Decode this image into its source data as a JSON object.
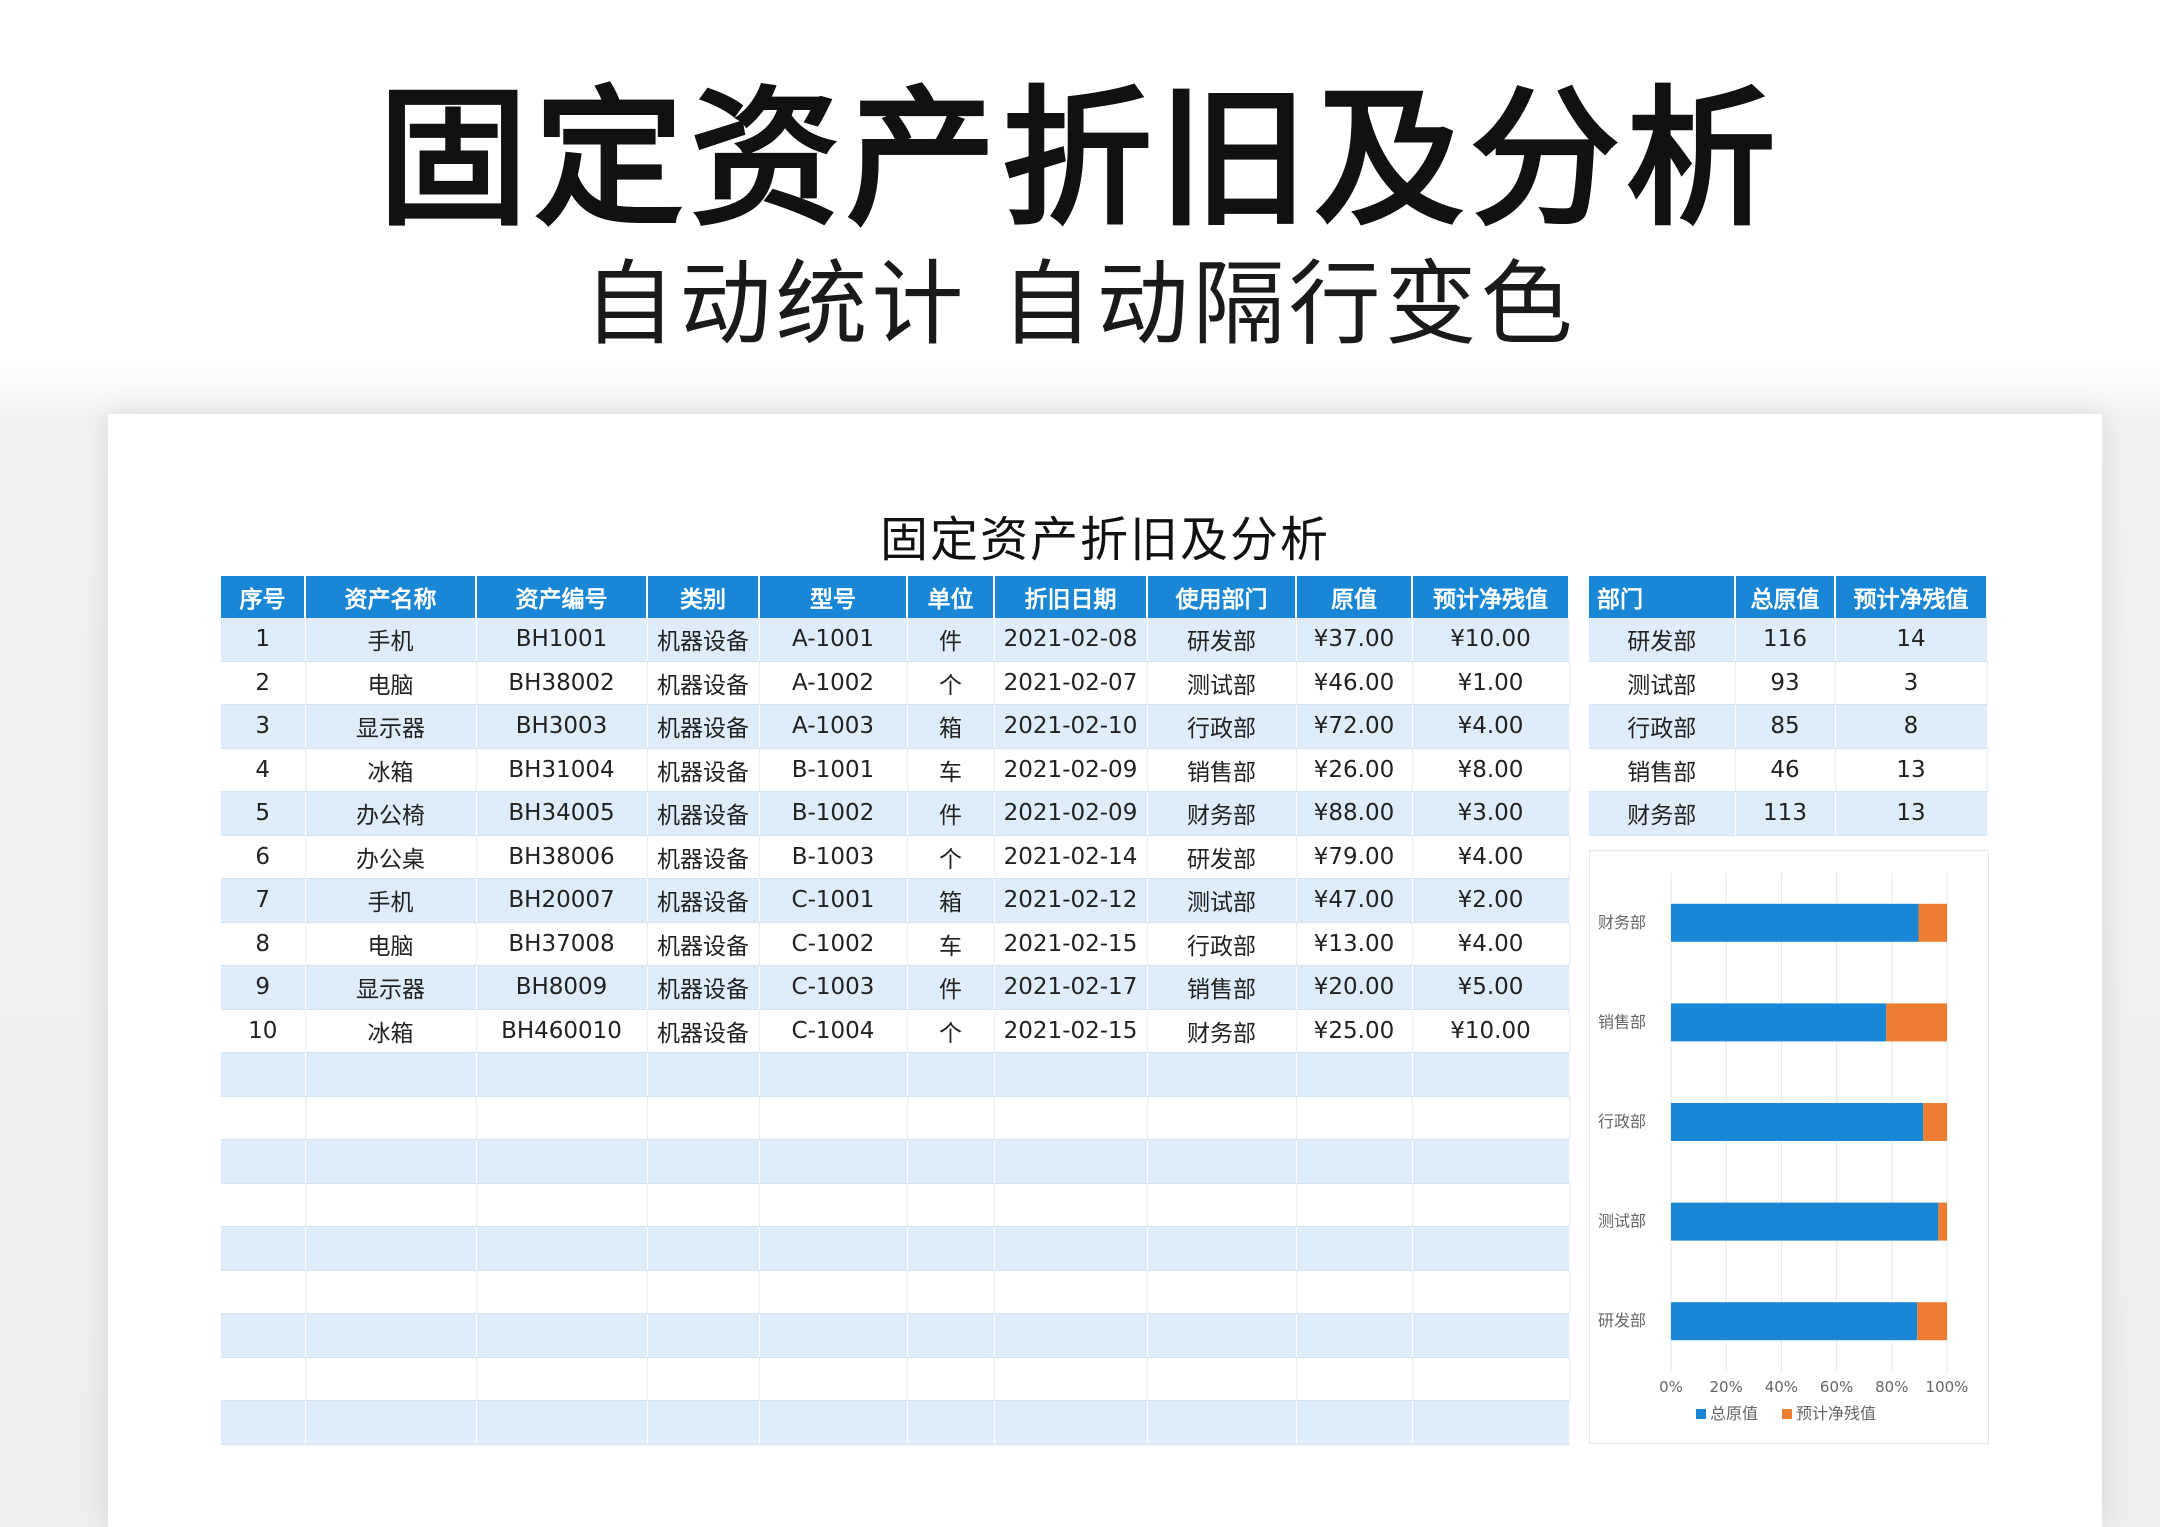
{
  "hero": {
    "title": "固定资产折旧及分析",
    "subtitle": "自动统计 自动隔行变色"
  },
  "sheet": {
    "title": "固定资产折旧及分析"
  },
  "main_table": {
    "headers": [
      "序号",
      "资产名称",
      "资产编号",
      "类别",
      "型号",
      "单位",
      "折旧日期",
      "使用部门",
      "原值",
      "预计净残值"
    ],
    "rows": [
      [
        "1",
        "手机",
        "BH1001",
        "机器设备",
        "A-1001",
        "件",
        "2021-02-08",
        "研发部",
        "¥37.00",
        "¥10.00"
      ],
      [
        "2",
        "电脑",
        "BH38002",
        "机器设备",
        "A-1002",
        "个",
        "2021-02-07",
        "测试部",
        "¥46.00",
        "¥1.00"
      ],
      [
        "3",
        "显示器",
        "BH3003",
        "机器设备",
        "A-1003",
        "箱",
        "2021-02-10",
        "行政部",
        "¥72.00",
        "¥4.00"
      ],
      [
        "4",
        "冰箱",
        "BH31004",
        "机器设备",
        "B-1001",
        "车",
        "2021-02-09",
        "销售部",
        "¥26.00",
        "¥8.00"
      ],
      [
        "5",
        "办公椅",
        "BH34005",
        "机器设备",
        "B-1002",
        "件",
        "2021-02-09",
        "财务部",
        "¥88.00",
        "¥3.00"
      ],
      [
        "6",
        "办公桌",
        "BH38006",
        "机器设备",
        "B-1003",
        "个",
        "2021-02-14",
        "研发部",
        "¥79.00",
        "¥4.00"
      ],
      [
        "7",
        "手机",
        "BH20007",
        "机器设备",
        "C-1001",
        "箱",
        "2021-02-12",
        "测试部",
        "¥47.00",
        "¥2.00"
      ],
      [
        "8",
        "电脑",
        "BH37008",
        "机器设备",
        "C-1002",
        "车",
        "2021-02-15",
        "行政部",
        "¥13.00",
        "¥4.00"
      ],
      [
        "9",
        "显示器",
        "BH8009",
        "机器设备",
        "C-1003",
        "件",
        "2021-02-17",
        "销售部",
        "¥20.00",
        "¥5.00"
      ],
      [
        "10",
        "冰箱",
        "BH460010",
        "机器设备",
        "C-1004",
        "个",
        "2021-02-15",
        "财务部",
        "¥25.00",
        "¥10.00"
      ],
      [
        "",
        "",
        "",
        "",
        "",
        "",
        "",
        "",
        "",
        ""
      ],
      [
        "",
        "",
        "",
        "",
        "",
        "",
        "",
        "",
        "",
        ""
      ],
      [
        "",
        "",
        "",
        "",
        "",
        "",
        "",
        "",
        "",
        ""
      ],
      [
        "",
        "",
        "",
        "",
        "",
        "",
        "",
        "",
        "",
        ""
      ],
      [
        "",
        "",
        "",
        "",
        "",
        "",
        "",
        "",
        "",
        ""
      ],
      [
        "",
        "",
        "",
        "",
        "",
        "",
        "",
        "",
        "",
        ""
      ],
      [
        "",
        "",
        "",
        "",
        "",
        "",
        "",
        "",
        "",
        ""
      ],
      [
        "",
        "",
        "",
        "",
        "",
        "",
        "",
        "",
        "",
        ""
      ],
      [
        "",
        "",
        "",
        "",
        "",
        "",
        "",
        "",
        "",
        ""
      ]
    ]
  },
  "dept_table": {
    "headers": [
      "部门",
      "总原值",
      "预计净残值"
    ],
    "rows": [
      [
        "研发部",
        "116",
        "14"
      ],
      [
        "测试部",
        "93",
        "3"
      ],
      [
        "行政部",
        "85",
        "8"
      ],
      [
        "销售部",
        "46",
        "13"
      ],
      [
        "财务部",
        "113",
        "13"
      ]
    ]
  },
  "chart_data": {
    "type": "bar",
    "orientation": "horizontal",
    "stacked": "percent",
    "categories": [
      "财务部",
      "销售部",
      "行政部",
      "测试部",
      "研发部"
    ],
    "series": [
      {
        "name": "总原值",
        "values": [
          113,
          46,
          85,
          93,
          116
        ],
        "color": "#1a86d6"
      },
      {
        "name": "预计净残值",
        "values": [
          13,
          13,
          8,
          3,
          14
        ],
        "color": "#ed7d31"
      }
    ],
    "xlim": [
      0,
      100
    ],
    "xticks": [
      "0%",
      "20%",
      "40%",
      "60%",
      "80%",
      "100%"
    ],
    "grid": "vertical",
    "legend": "bottom"
  }
}
